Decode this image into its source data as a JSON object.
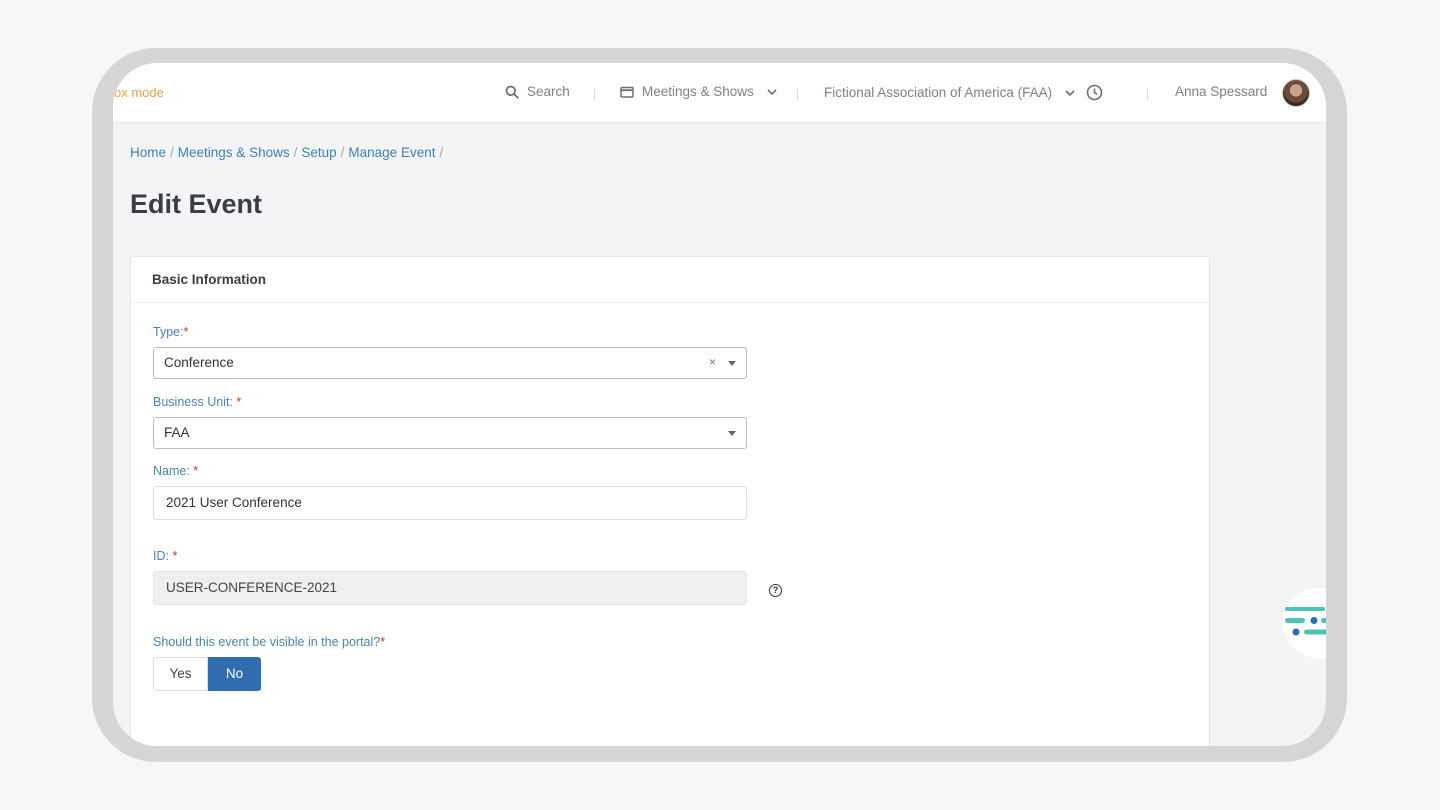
{
  "topbar": {
    "sandbox_text": "ox mode",
    "search_label": "Search",
    "module_label": "Meetings & Shows",
    "org_label": "Fictional Association of America (FAA)",
    "user_name": "Anna Spessard"
  },
  "breadcrumb": [
    "Home",
    "Meetings & Shows",
    "Setup",
    "Manage Event"
  ],
  "page_title": "Edit Event",
  "form": {
    "section_title": "Basic Information",
    "type_label": "Type:",
    "type_value": "Conference",
    "business_unit_label": "Business Unit: ",
    "business_unit_value": "FAA",
    "name_label": "Name: ",
    "name_value": "2021 User Conference",
    "id_label": "ID: ",
    "id_value": "USER-CONFERENCE-2021",
    "help_glyph": "?",
    "visible_label": "Should this event be visible in the portal?",
    "visible_yes": "Yes",
    "visible_no": "No",
    "visible_selected": "No",
    "required_mark": "*",
    "clear_glyph": "×"
  },
  "colors": {
    "accent": "#2f6db0",
    "link": "#3f7fb6",
    "sandbox": "#e8a04b",
    "required": "#c9302c"
  },
  "breadcrumb_sep": "/"
}
